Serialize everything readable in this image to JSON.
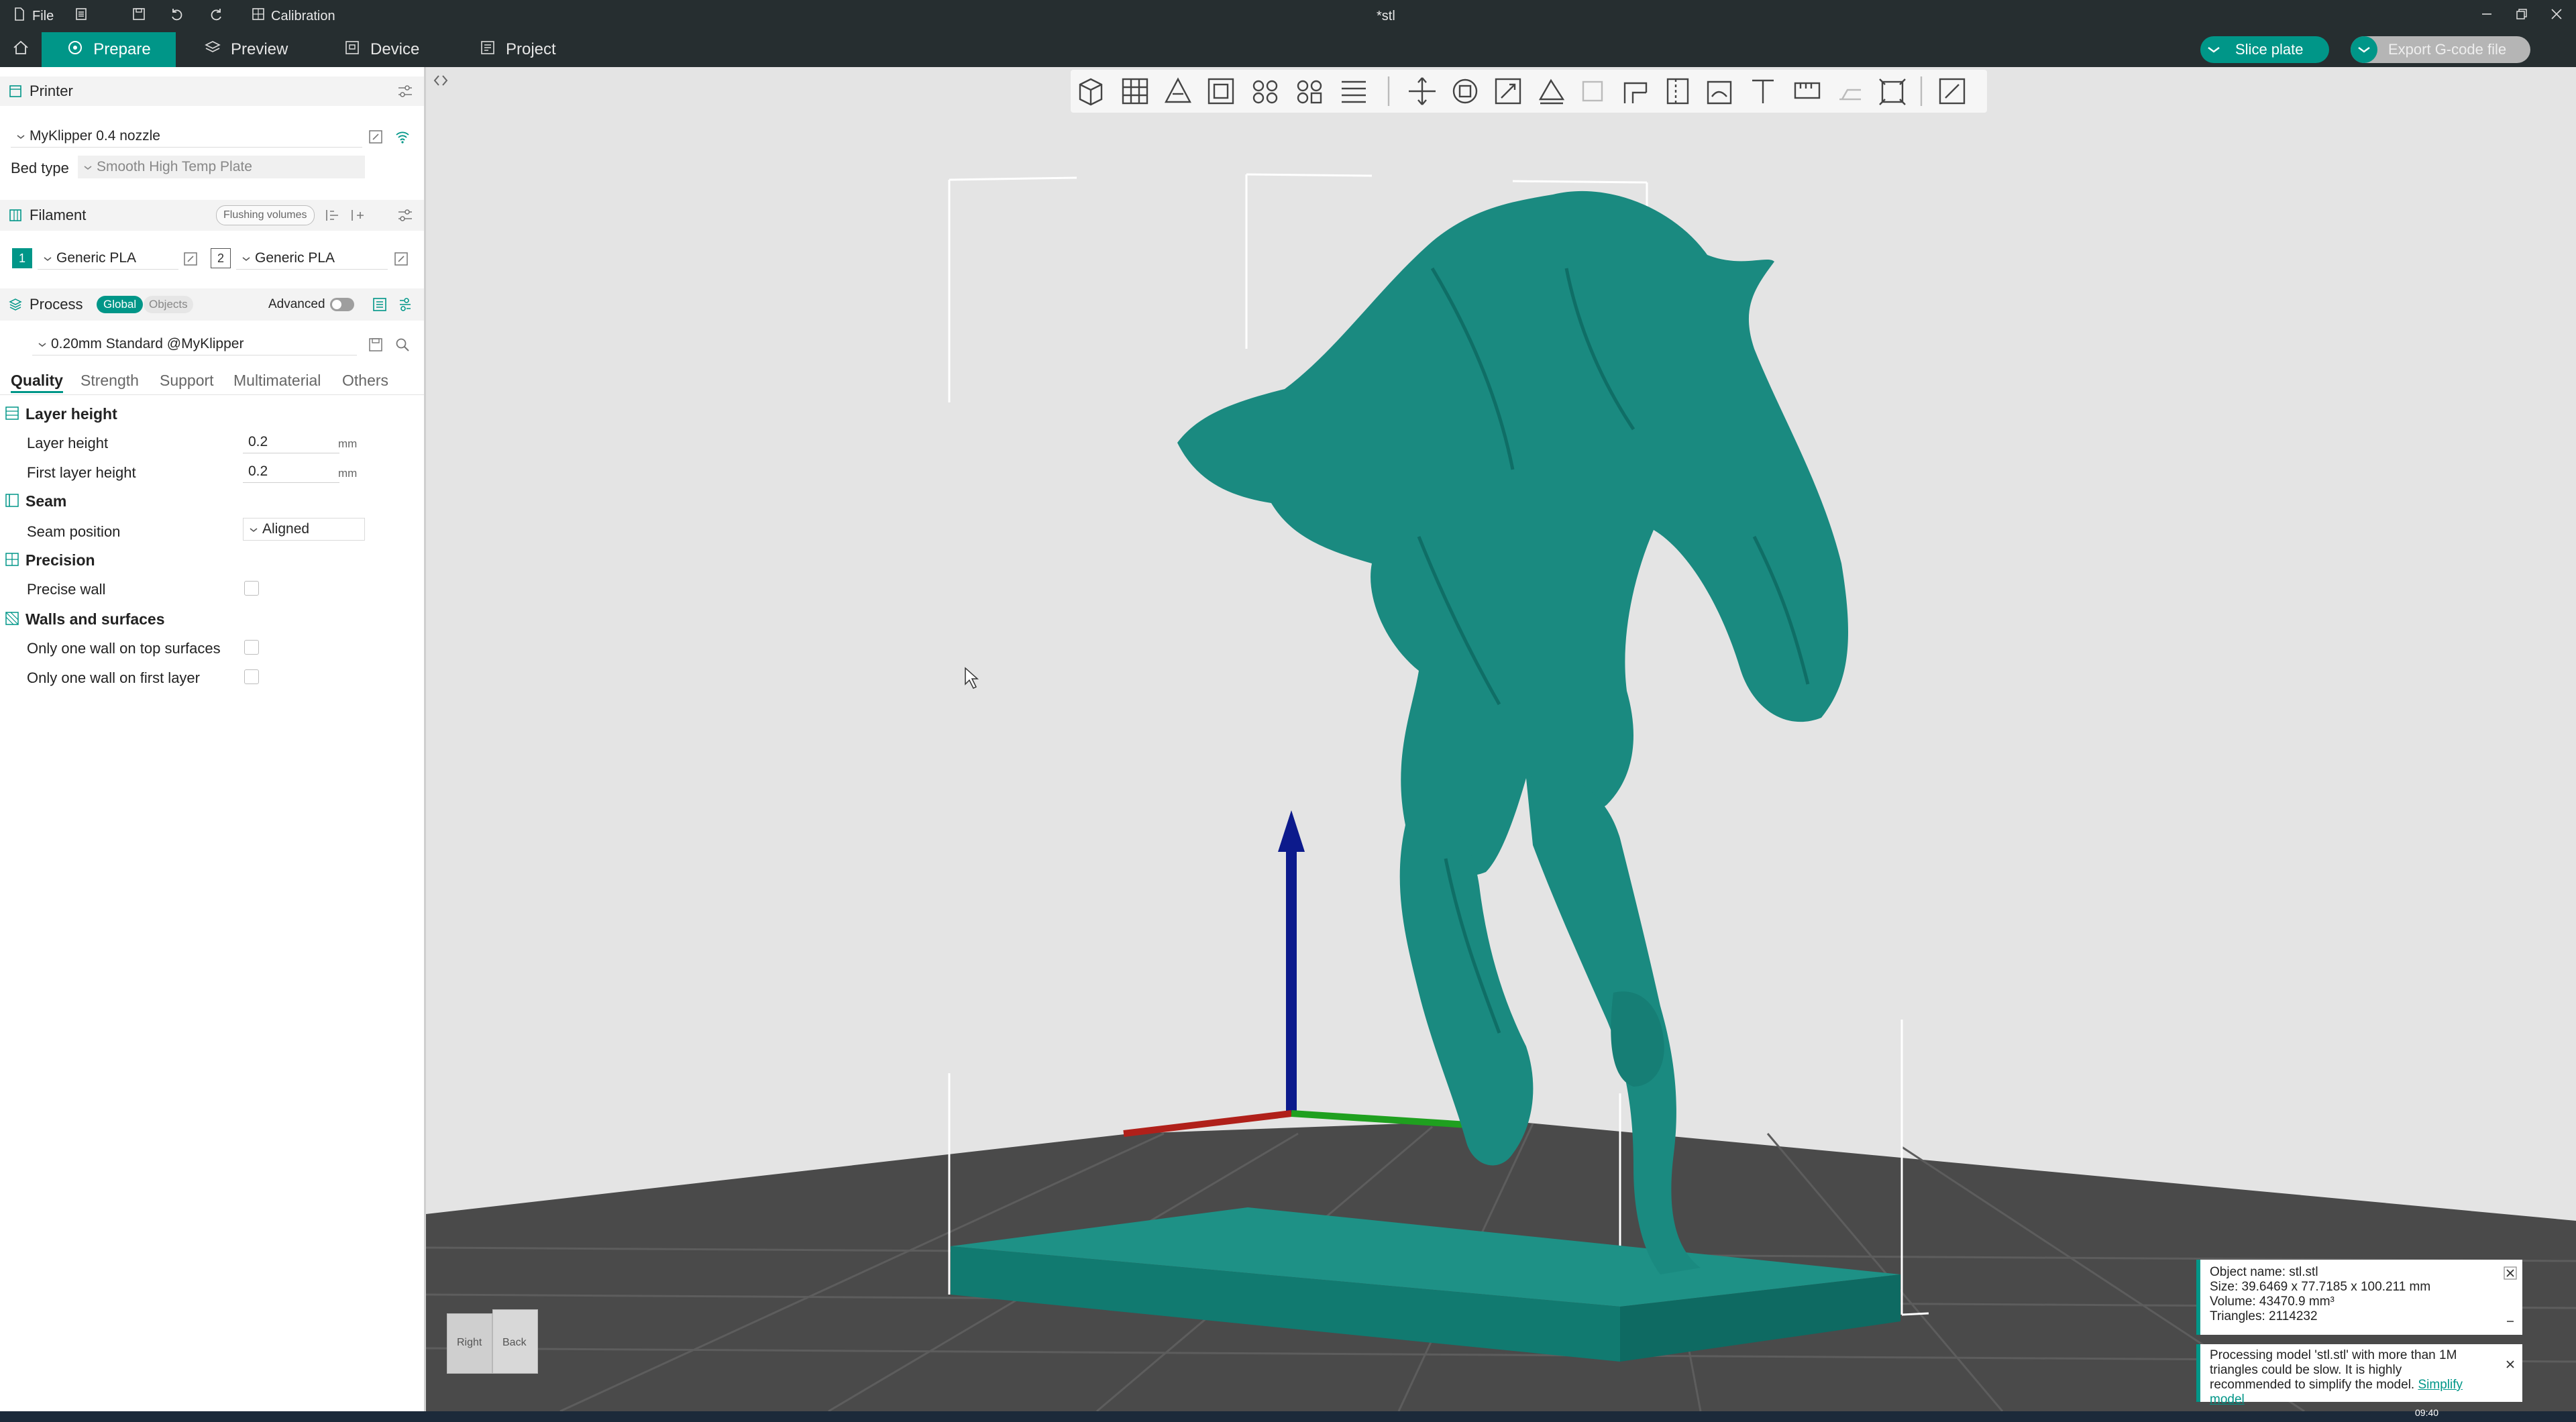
{
  "titlebar": {
    "file_label": "File",
    "calibration_label": "Calibration",
    "doc_title": "*stl"
  },
  "tabs": {
    "prepare": "Prepare",
    "preview": "Preview",
    "device": "Device",
    "project": "Project"
  },
  "actions": {
    "slice_plate": "Slice plate",
    "export_gcode": "Export G-code file"
  },
  "printer": {
    "section_title": "Printer",
    "preset": "MyKlipper 0.4 nozzle",
    "bed_type_label": "Bed type",
    "bed_type_value": "Smooth High Temp Plate"
  },
  "filament": {
    "section_title": "Filament",
    "flushing_volumes": "Flushing volumes",
    "slots": [
      {
        "index": "1",
        "name": "Generic PLA"
      },
      {
        "index": "2",
        "name": "Generic PLA"
      }
    ]
  },
  "process": {
    "section_title": "Process",
    "global_label": "Global",
    "objects_label": "Objects",
    "advanced_label": "Advanced",
    "preset": "0.20mm Standard @MyKlipper",
    "tabs": [
      "Quality",
      "Strength",
      "Support",
      "Multimaterial",
      "Others"
    ]
  },
  "quality": {
    "layer_height_group": "Layer height",
    "layer_height_label": "Layer height",
    "layer_height_value": "0.2",
    "first_layer_height_label": "First layer height",
    "first_layer_height_value": "0.2",
    "unit_mm": "mm",
    "seam_group": "Seam",
    "seam_position_label": "Seam position",
    "seam_position_value": "Aligned",
    "precision_group": "Precision",
    "precise_wall_label": "Precise wall",
    "walls_group": "Walls and surfaces",
    "only_one_wall_top_label": "Only one wall on top surfaces",
    "only_one_wall_first_label": "Only one wall on first layer"
  },
  "viewcube": {
    "right": "Right",
    "back": "Back"
  },
  "object_info": {
    "name": "Object name: stl.stl",
    "size": "Size: 39.6469 x 77.7185 x 100.211 mm",
    "volume": "Volume: 43470.9 mm³",
    "triangles": "Triangles: 2114232"
  },
  "warning": {
    "text": "Processing model 'stl.stl' with more than 1M triangles could be slow. It is highly recommended to simplify the model.",
    "link": "Simplify model"
  },
  "taskbar": {
    "time": "09:40"
  },
  "colors": {
    "accent": "#009688",
    "titlebar_bg": "#262e30",
    "model": "#1a8a80",
    "axis_z": "#0c1a8c",
    "axis_x": "#b0201a",
    "axis_y": "#1fa01f"
  }
}
